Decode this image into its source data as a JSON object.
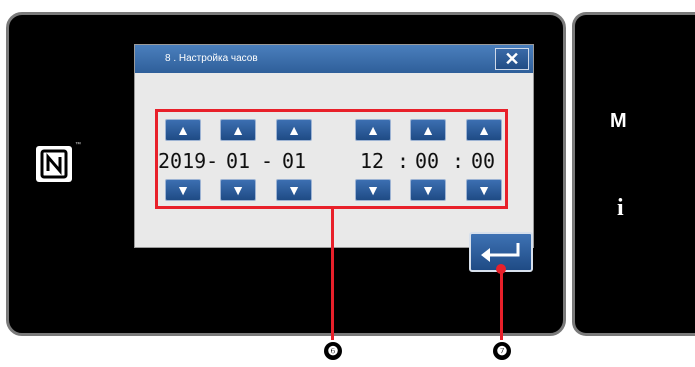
{
  "dialog": {
    "title": "8 . Настройка часов",
    "close_label": "✕"
  },
  "datetime": {
    "year": "2019-",
    "month": "01",
    "day": "01",
    "sep_date_1": "-",
    "hour": "12",
    "minute": "00",
    "second": "00",
    "sep_time_1": ":",
    "sep_time_2": ":"
  },
  "arrows": {
    "up": "▲",
    "down": "▼"
  },
  "side_panel": {
    "menu_label": "M",
    "info_label": "i"
  },
  "nfc": {
    "tm": "™"
  },
  "callouts": {
    "box": "❻",
    "enter": "❼"
  },
  "colors": {
    "highlight": "#e8202a",
    "button_blue": "#2f5f9a",
    "dialog_bg": "#e9e9e9"
  },
  "icons": {
    "nfc": "nfc-icon",
    "enter": "enter-return-icon",
    "close": "close-icon"
  }
}
